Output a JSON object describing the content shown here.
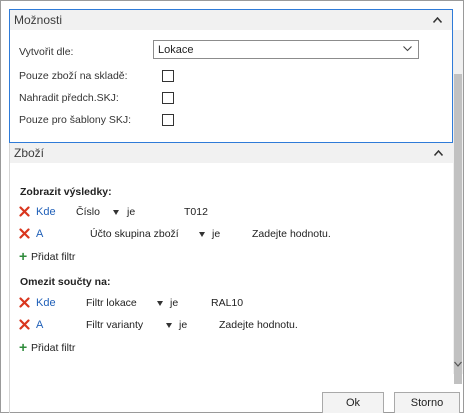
{
  "options": {
    "title": "Možnosti",
    "create_by_label": "Vytvořit dle:",
    "create_by_value": "Lokace",
    "only_stock_label": "Pouze zboží na skladě:",
    "replace_prev_label": "Nahradit předch.SKJ:",
    "only_templates_label": "Pouze pro šablony SKJ:"
  },
  "goods": {
    "title": "Zboží",
    "show_results": {
      "heading": "Zobrazit výsledky:",
      "filters": [
        {
          "conj": "Kde",
          "field": "Číslo",
          "op": "je",
          "value": "T012"
        },
        {
          "conj": "A",
          "field": "Účto skupina zboží",
          "op": "je",
          "value": "Zadejte hodnotu."
        }
      ],
      "add_filter": "Přidat filtr"
    },
    "limit_totals": {
      "heading": "Omezit součty na:",
      "filters": [
        {
          "conj": "Kde",
          "field": "Filtr lokace",
          "op": "je",
          "value": "RAL10"
        },
        {
          "conj": "A",
          "field": "Filtr varianty",
          "op": "je",
          "value": "Zadejte hodnotu."
        }
      ],
      "add_filter": "Přidat filtr"
    }
  },
  "buttons": {
    "ok": "Ok",
    "cancel": "Storno"
  },
  "colors": {
    "accent_border": "#2f7bd8",
    "remove_icon": "#d9361e",
    "add_icon": "#2e8b3a",
    "conj_text": "#1f5fb8"
  }
}
